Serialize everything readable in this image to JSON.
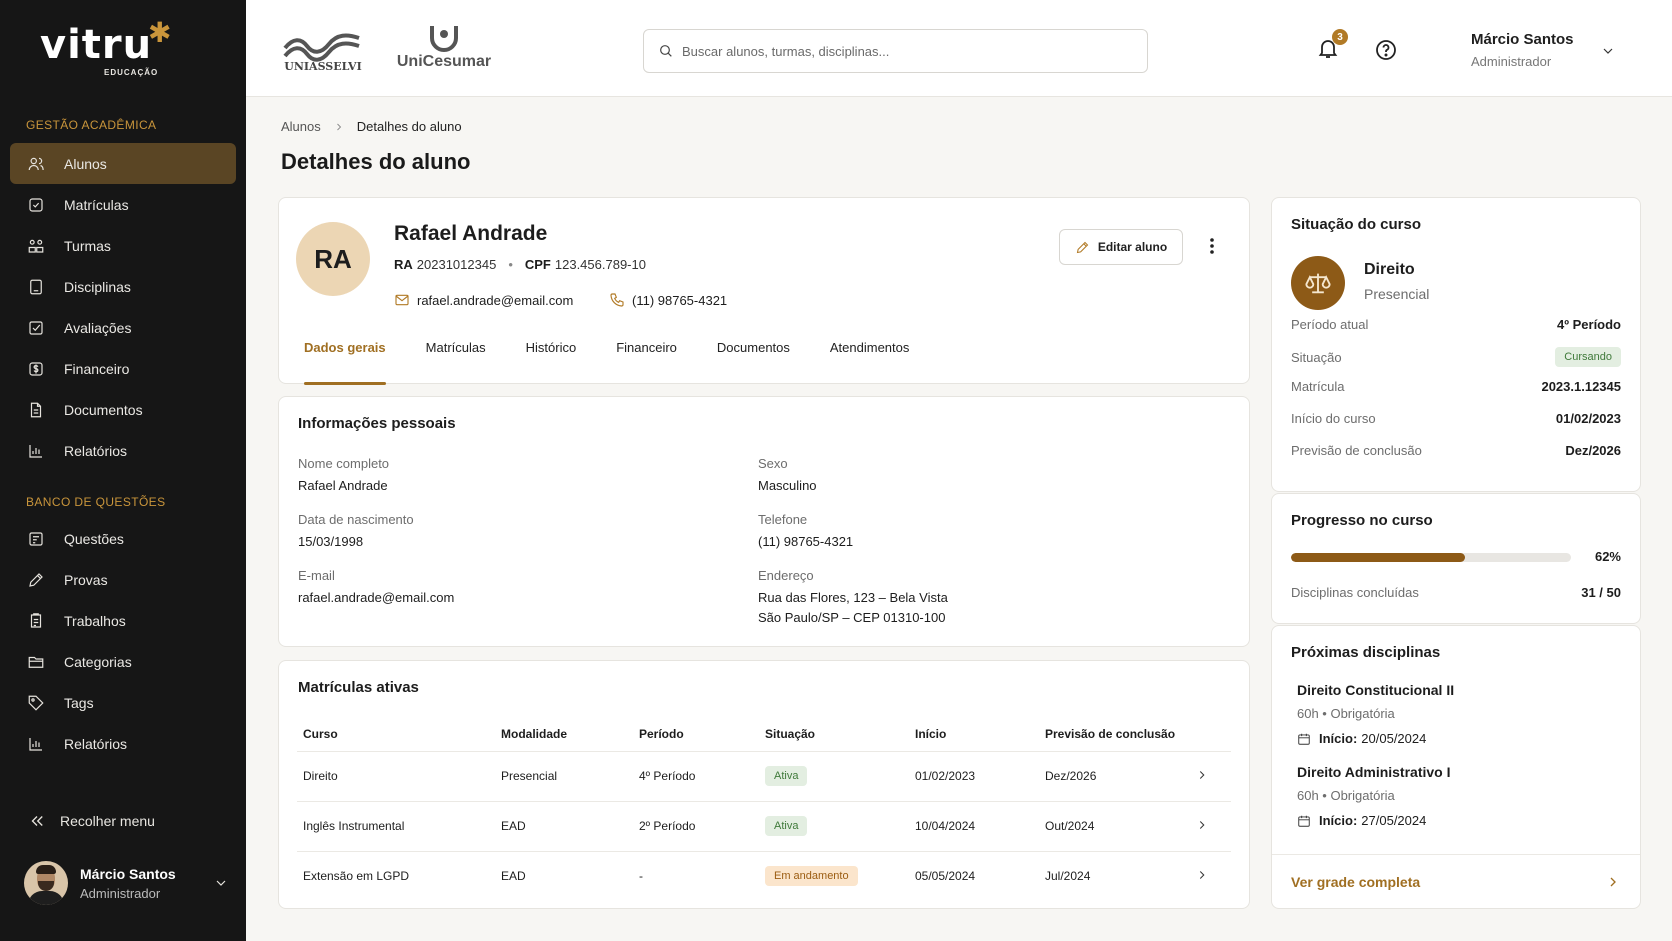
{
  "sidebar": {
    "logo_word": "vitru",
    "logo_sub": "EDUCAÇÃO",
    "section1": "GESTÃO ACADÊMICA",
    "section2": "BANCO DE QUESTÕES",
    "items1": [
      {
        "label": "Alunos",
        "icon": "users-icon",
        "active": true
      },
      {
        "label": "Matrículas",
        "icon": "enrollment-icon"
      },
      {
        "label": "Turmas",
        "icon": "classes-icon"
      },
      {
        "label": "Disciplinas",
        "icon": "book-icon"
      },
      {
        "label": "Avaliações",
        "icon": "clipboard-check-icon"
      },
      {
        "label": "Financeiro",
        "icon": "money-icon"
      },
      {
        "label": "Documentos",
        "icon": "document-icon"
      },
      {
        "label": "Relatórios",
        "icon": "chart-icon"
      }
    ],
    "items2": [
      {
        "label": "Questões",
        "icon": "question-icon"
      },
      {
        "label": "Provas",
        "icon": "pencil-icon"
      },
      {
        "label": "Trabalhos",
        "icon": "assignment-icon"
      },
      {
        "label": "Categorias",
        "icon": "folder-icon"
      },
      {
        "label": "Tags",
        "icon": "tag-icon"
      },
      {
        "label": "Relatórios",
        "icon": "chart-icon"
      }
    ],
    "collapse_label": "Recolher menu",
    "user": {
      "name": "Márcio Santos",
      "role": "Administrador"
    }
  },
  "topbar": {
    "brand1": "UNIASSELVI",
    "brand2": "UniCesumar",
    "search_placeholder": "Buscar alunos, turmas, disciplinas...",
    "notifications": "3",
    "user": {
      "name": "Márcio Santos",
      "role": "Administrador"
    }
  },
  "breadcrumb": {
    "parent": "Alunos",
    "current": "Detalhes do aluno"
  },
  "page_title": "Detalhes do aluno",
  "profile": {
    "initials": "RA",
    "name": "Rafael Andrade",
    "ra_label": "RA",
    "ra": "20231012345",
    "cpf_label": "CPF",
    "cpf": "123.456.789-10",
    "email": "rafael.andrade@email.com",
    "phone": "(11) 98765-4321",
    "edit_label": "Editar aluno",
    "tabs": [
      "Dados gerais",
      "Matrículas",
      "Histórico",
      "Financeiro",
      "Documentos",
      "Atendimentos"
    ]
  },
  "personal": {
    "title": "Informações pessoais",
    "name_label": "Nome completo",
    "name": "Rafael Andrade",
    "birth_label": "Data de nascimento",
    "birth": "15/03/1998",
    "email_label": "E-mail",
    "email": "rafael.andrade@email.com",
    "sex_label": "Sexo",
    "sex": "Masculino",
    "phone_label": "Telefone",
    "phone": "(11) 98765-4321",
    "address_label": "Endereço",
    "address_line1": "Rua das Flores, 123 – Bela Vista",
    "address_line2": "São Paulo/SP – CEP 01310-100"
  },
  "enrollments": {
    "title": "Matrículas ativas",
    "headers": [
      "Curso",
      "Modalidade",
      "Período",
      "Situação",
      "Início",
      "Previsão de conclusão"
    ],
    "rows": [
      {
        "curso": "Direito",
        "modalidade": "Presencial",
        "periodo": "4º Período",
        "situacao": "Ativa",
        "status_color": "#3f7a3a",
        "inicio": "01/02/2023",
        "previsao": "Dez/2026"
      },
      {
        "curso": "Inglês Instrumental",
        "modalidade": "EAD",
        "periodo": "2º Período",
        "situacao": "Ativa",
        "status_color": "#3f7a3a",
        "inicio": "10/04/2024",
        "previsao": "Out/2024"
      },
      {
        "curso": "Extensão em LGPD",
        "modalidade": "EAD",
        "periodo": "-",
        "situacao": "Em andamento",
        "status_color": "#9c5d12",
        "inicio": "05/05/2024",
        "previsao": "Jul/2024"
      }
    ]
  },
  "status": {
    "title": "Situação do curso",
    "course": "Direito",
    "mode": "Presencial",
    "rows": [
      {
        "k": "Período atual",
        "v": "4º Período"
      },
      {
        "k": "Situação",
        "v": "Cursando"
      },
      {
        "k": "Matrícula",
        "v": "2023.1.12345"
      },
      {
        "k": "Início do curso",
        "v": "01/02/2023"
      },
      {
        "k": "Previsão de conclusão",
        "v": "Dez/2026"
      }
    ]
  },
  "progress": {
    "title": "Progresso no curso",
    "percent": 62,
    "percent_label": "62%",
    "disc_label": "Disciplinas concluídas",
    "disc_value": "31 / 50"
  },
  "next": {
    "title": "Próximas disciplinas",
    "items": [
      {
        "name": "Direito Constitucional II",
        "meta": "60h • Obrigatória",
        "start_label": "Início:",
        "start": "20/05/2024"
      },
      {
        "name": "Direito Administrativo I",
        "meta": "60h • Obrigatória",
        "start_label": "Início:",
        "start": "27/05/2024"
      }
    ],
    "link": "Ver grade completa"
  },
  "colors": {
    "accent": "#a06f22",
    "sidebar_bg": "#161616",
    "active_nav": "#5a4524"
  }
}
